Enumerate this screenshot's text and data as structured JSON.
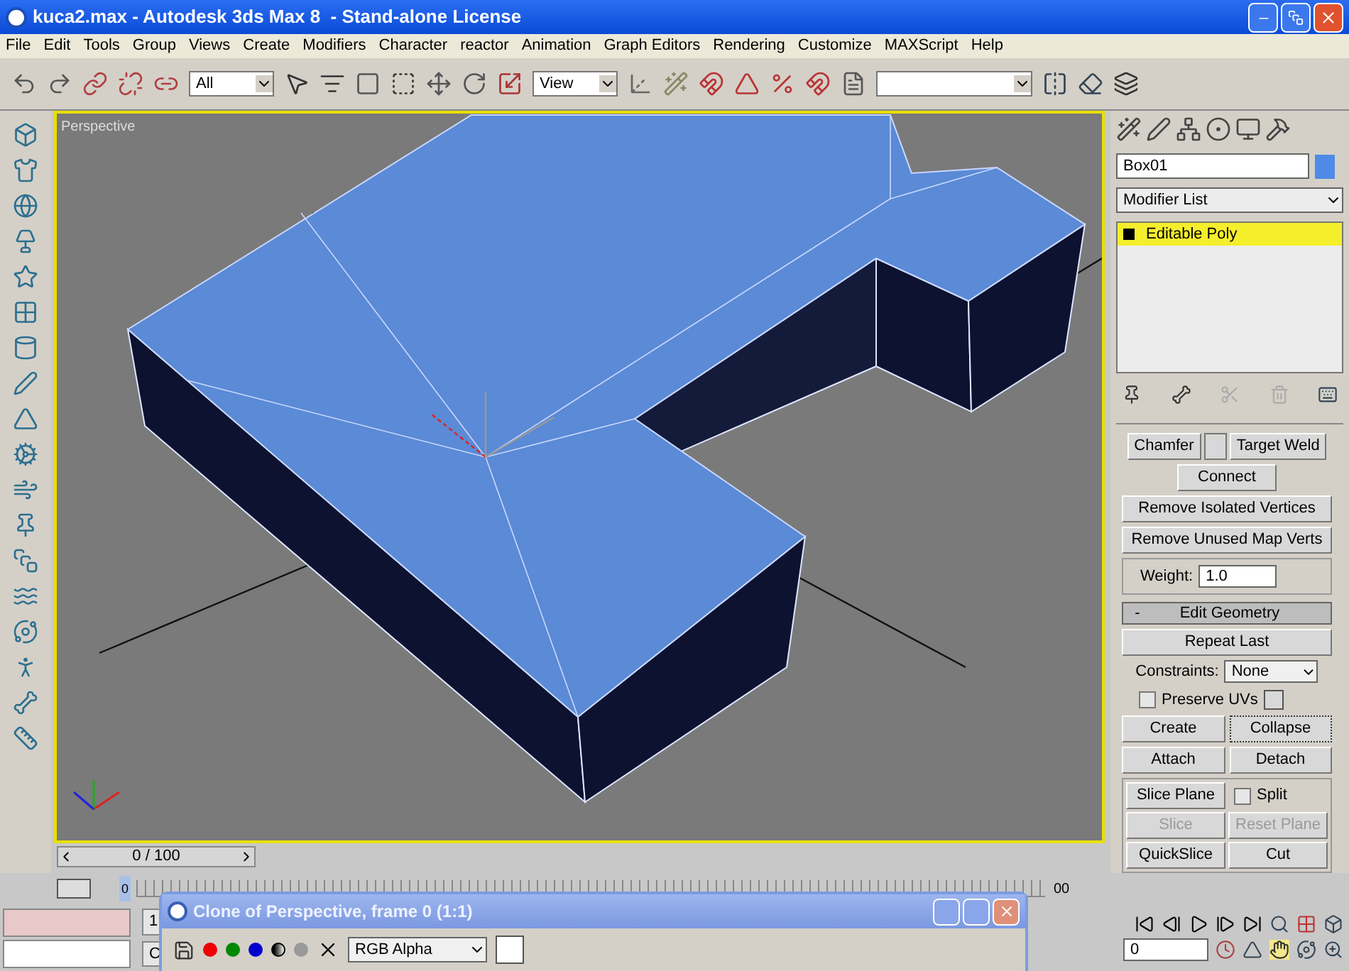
{
  "window": {
    "title": "kuca2.max - Autodesk 3ds Max 8  - Stand-alone License"
  },
  "menu": [
    "File",
    "Edit",
    "Tools",
    "Group",
    "Views",
    "Create",
    "Modifiers",
    "Character",
    "reactor",
    "Animation",
    "Graph Editors",
    "Rendering",
    "Customize",
    "MAXScript",
    "Help"
  ],
  "toolbar": {
    "selection_filter": "All",
    "reference_coordinate": "View"
  },
  "viewport": {
    "label": "Perspective"
  },
  "command_panel": {
    "object_name": "Box01",
    "modifier_list": "Modifier List",
    "stack": [
      {
        "label": "Editable Poly",
        "selected": true
      }
    ],
    "edit_edges": {
      "chamfer": "Chamfer",
      "target_weld": "Target Weld",
      "connect": "Connect",
      "remove_isolated": "Remove Isolated Vertices",
      "remove_unused": "Remove Unused Map Verts",
      "weight_label": "Weight:",
      "weight_value": "1.0"
    },
    "edit_geometry": {
      "toggle": "-",
      "title": "Edit Geometry",
      "repeat_last": "Repeat Last",
      "constraints_label": "Constraints:",
      "constraints_value": "None",
      "preserve_uvs": {
        "label": "Preserve UVs",
        "checked": false
      },
      "buttons": [
        {
          "label": "Create",
          "disabled": false
        },
        {
          "label": "Collapse",
          "disabled": false
        },
        {
          "label": "Attach",
          "disabled": false
        },
        {
          "label": "Detach",
          "disabled": false
        }
      ],
      "slice_plane": "Slice Plane",
      "split": {
        "label": "Split",
        "checked": false
      },
      "slice_buttons": [
        {
          "label": "Slice",
          "disabled": true
        },
        {
          "label": "Reset Plane",
          "disabled": true
        },
        {
          "label": "QuickSlice",
          "disabled": false
        },
        {
          "label": "Cut",
          "disabled": false
        }
      ]
    }
  },
  "time_slider": {
    "label": "0 / 100",
    "thumb": "0",
    "ruler_end": "00"
  },
  "status": {
    "field_1": "1",
    "field_2": "C",
    "frame_value": "0"
  },
  "render_window": {
    "title": "Clone of Perspective, frame 0 (1:1)",
    "channel": "RGB Alpha"
  }
}
